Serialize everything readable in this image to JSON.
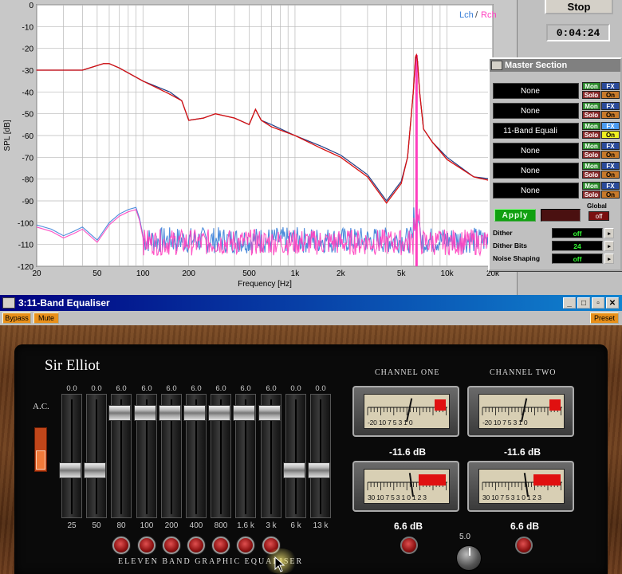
{
  "spl_chart": {
    "ylabel": "SPL [dB]",
    "xlabel": "Frequency [Hz]",
    "legend_l": "Lch",
    "legend_sep": " / ",
    "legend_r": "Rch",
    "y_ticks": [
      "0",
      "-10",
      "-20",
      "-30",
      "-40",
      "-50",
      "-60",
      "-70",
      "-80",
      "-90",
      "-100",
      "-110",
      "-120"
    ],
    "x_ticks": [
      "20",
      "50",
      "100",
      "200",
      "500",
      "1k",
      "2k",
      "5k",
      "10k",
      "20k"
    ],
    "colors": {
      "lch": "#3a7fd8",
      "rch": "#ff3fbf",
      "main": "#d81010"
    }
  },
  "chart_data": {
    "type": "line",
    "title": "",
    "xlabel": "Frequency [Hz]",
    "ylabel": "SPL [dB]",
    "x_scale": "log",
    "xlim": [
      20,
      20000
    ],
    "ylim": [
      -120,
      0
    ],
    "grid": true,
    "legend": "top-right",
    "series": [
      {
        "name": "Lch",
        "x": [
          20,
          40,
          55,
          60,
          70,
          100,
          150,
          180,
          200,
          250,
          300,
          400,
          500,
          550,
          600,
          700,
          1000,
          1500,
          2000,
          3000,
          4000,
          5000,
          5500,
          6000,
          6200,
          6300,
          6400,
          6600,
          7000,
          8000,
          10000,
          15000,
          20000
        ],
        "y": [
          -30,
          -30,
          -27,
          -27,
          -29,
          -35,
          -40,
          -44,
          -53,
          -52,
          -50,
          -52,
          -55,
          -48,
          -53,
          -55,
          -60,
          -65,
          -69,
          -78,
          -90,
          -81,
          -70,
          -40,
          -25,
          -23,
          -26,
          -40,
          -57,
          -63,
          -70,
          -79,
          -80
        ]
      },
      {
        "name": "Rch",
        "x": [
          20,
          40,
          55,
          60,
          70,
          100,
          150,
          180,
          200,
          250,
          300,
          400,
          500,
          550,
          600,
          700,
          1000,
          1500,
          2000,
          3000,
          4000,
          5000,
          5500,
          6000,
          6200,
          6300,
          6400,
          6600,
          7000,
          8000,
          10000,
          15000,
          20000
        ],
        "y": [
          -30,
          -30,
          -27,
          -27,
          -29,
          -35,
          -41,
          -44,
          -53,
          -52,
          -50,
          -52,
          -55,
          -48,
          -53,
          -56,
          -60,
          -66,
          -70,
          -79,
          -91,
          -82,
          -70,
          -40,
          -24,
          -23,
          -26,
          -40,
          -57,
          -63,
          -71,
          -79,
          -81
        ]
      }
    ]
  },
  "transport": {
    "stop_label": "Stop",
    "time": "0:04:24"
  },
  "master": {
    "title": "Master Section",
    "slots": [
      {
        "name": "None",
        "mon": "Mon",
        "fx": "FX",
        "solo": "Solo",
        "on": "On"
      },
      {
        "name": "None",
        "mon": "Mon",
        "fx": "FX",
        "solo": "Solo",
        "on": "On"
      },
      {
        "name": "11-Band Equali",
        "mon": "Mon",
        "fx": "FX",
        "solo": "Solo",
        "on": "On"
      },
      {
        "name": "None",
        "mon": "Mon",
        "fx": "FX",
        "solo": "Solo",
        "on": "On"
      },
      {
        "name": "None",
        "mon": "Mon",
        "fx": "FX",
        "solo": "Solo",
        "on": "On"
      },
      {
        "name": "None",
        "mon": "Mon",
        "fx": "FX",
        "solo": "Solo",
        "on": "On"
      }
    ],
    "dropdown_glyph": "▼",
    "apply_label": "Apply",
    "global_label": "Global",
    "global_value": "off",
    "dither_label": "Dither",
    "dither_value": "off",
    "dither_bits_label": "Dither Bits",
    "dither_bits_value": "24",
    "noise_shaping_label": "Noise Shaping",
    "noise_shaping_value": "off",
    "spin_glyph": "▸"
  },
  "eq_window": {
    "title": "3:11-Band Equaliser",
    "minimize": "_",
    "maximize": "□",
    "restore": "▫",
    "close": "✕",
    "bypass_label": "Bypass",
    "mute_label": "Mute",
    "preset_label": "Preset",
    "brand": "Sir Elliot",
    "ac_label": "A.C.",
    "footer": "ELEVEN BAND GRAPHIC EQUALISER",
    "bands": [
      {
        "value": "0.0",
        "label": "25",
        "level": 0
      },
      {
        "value": "0.0",
        "label": "50",
        "level": 0
      },
      {
        "value": "6.0",
        "label": "80",
        "level": 6
      },
      {
        "value": "6.0",
        "label": "100",
        "level": 6
      },
      {
        "value": "6.0",
        "label": "200",
        "level": 6
      },
      {
        "value": "6.0",
        "label": "400",
        "level": 6
      },
      {
        "value": "6.0",
        "label": "800",
        "level": 6
      },
      {
        "value": "6.0",
        "label": "1.6 k",
        "level": 6
      },
      {
        "value": "6.0",
        "label": "3 k",
        "level": 6
      },
      {
        "value": "0.0",
        "label": "6 k",
        "level": 0
      },
      {
        "value": "0.0",
        "label": "13 k",
        "level": 0
      }
    ],
    "channel_one": "CHANNEL ONE",
    "channel_two": "CHANNEL TWO",
    "meter_scale_top": "-20 10 7 5 3 1 0",
    "meter_scale_bottom": "30 10 7 5 3 1 0 1 2 3",
    "ch1_input_db": "-11.6 dB",
    "ch2_input_db": "-11.6 dB",
    "ch1_output_db": "6.6 dB",
    "ch2_output_db": "6.6 dB",
    "balance_value": "5.0"
  }
}
